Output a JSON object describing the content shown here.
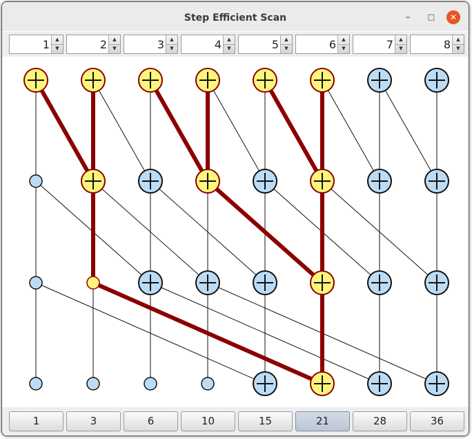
{
  "window": {
    "title": "Step Efficient Scan",
    "minimize_label": "–",
    "maximize_label": "□",
    "close_label": "✕"
  },
  "spinners": [
    {
      "value": "1"
    },
    {
      "value": "2"
    },
    {
      "value": "3"
    },
    {
      "value": "4"
    },
    {
      "value": "5"
    },
    {
      "value": "6"
    },
    {
      "value": "7"
    },
    {
      "value": "8"
    }
  ],
  "results": [
    {
      "label": "1"
    },
    {
      "label": "3"
    },
    {
      "label": "6"
    },
    {
      "label": "10"
    },
    {
      "label": "15"
    },
    {
      "label": "21",
      "active": true
    },
    {
      "label": "28"
    },
    {
      "label": "36"
    }
  ],
  "colors": {
    "highlight_fill": "#fdf57c",
    "highlight_stroke": "#8b0000",
    "normal_fill": "#bcdcf5",
    "normal_stroke": "#111111",
    "path": "#8b0000",
    "edge": "#111111"
  },
  "graph": {
    "nodes": [
      {
        "col": 0,
        "level": 0,
        "type": "add",
        "highlight": true
      },
      {
        "col": 1,
        "level": 0,
        "type": "add",
        "highlight": true
      },
      {
        "col": 2,
        "level": 0,
        "type": "add",
        "highlight": true
      },
      {
        "col": 3,
        "level": 0,
        "type": "add",
        "highlight": true
      },
      {
        "col": 4,
        "level": 0,
        "type": "add",
        "highlight": true
      },
      {
        "col": 5,
        "level": 0,
        "type": "add",
        "highlight": true
      },
      {
        "col": 6,
        "level": 0,
        "type": "add",
        "highlight": false
      },
      {
        "col": 7,
        "level": 0,
        "type": "add",
        "highlight": false
      },
      {
        "col": 0,
        "level": 1,
        "type": "pass",
        "highlight": false
      },
      {
        "col": 1,
        "level": 1,
        "type": "add",
        "highlight": true
      },
      {
        "col": 2,
        "level": 1,
        "type": "add",
        "highlight": false
      },
      {
        "col": 3,
        "level": 1,
        "type": "add",
        "highlight": true
      },
      {
        "col": 4,
        "level": 1,
        "type": "add",
        "highlight": false
      },
      {
        "col": 5,
        "level": 1,
        "type": "add",
        "highlight": true
      },
      {
        "col": 6,
        "level": 1,
        "type": "add",
        "highlight": false
      },
      {
        "col": 7,
        "level": 1,
        "type": "add",
        "highlight": false
      },
      {
        "col": 0,
        "level": 2,
        "type": "pass",
        "highlight": false
      },
      {
        "col": 1,
        "level": 2,
        "type": "pass",
        "highlight": true
      },
      {
        "col": 2,
        "level": 2,
        "type": "add",
        "highlight": false
      },
      {
        "col": 3,
        "level": 2,
        "type": "add",
        "highlight": false
      },
      {
        "col": 4,
        "level": 2,
        "type": "add",
        "highlight": false
      },
      {
        "col": 5,
        "level": 2,
        "type": "add",
        "highlight": true
      },
      {
        "col": 6,
        "level": 2,
        "type": "add",
        "highlight": false
      },
      {
        "col": 7,
        "level": 2,
        "type": "add",
        "highlight": false
      },
      {
        "col": 0,
        "level": 3,
        "type": "pass",
        "highlight": false
      },
      {
        "col": 1,
        "level": 3,
        "type": "pass",
        "highlight": false
      },
      {
        "col": 2,
        "level": 3,
        "type": "pass",
        "highlight": false
      },
      {
        "col": 3,
        "level": 3,
        "type": "pass",
        "highlight": false
      },
      {
        "col": 4,
        "level": 3,
        "type": "add",
        "highlight": false
      },
      {
        "col": 5,
        "level": 3,
        "type": "add",
        "highlight": true
      },
      {
        "col": 6,
        "level": 3,
        "type": "add",
        "highlight": false
      },
      {
        "col": 7,
        "level": 3,
        "type": "add",
        "highlight": false
      }
    ],
    "edges": [
      {
        "from": [
          0,
          0
        ],
        "to": [
          0,
          1
        ],
        "highlight": false
      },
      {
        "from": [
          0,
          0
        ],
        "to": [
          1,
          1
        ],
        "highlight": true
      },
      {
        "from": [
          1,
          0
        ],
        "to": [
          1,
          1
        ],
        "highlight": true
      },
      {
        "from": [
          1,
          0
        ],
        "to": [
          2,
          1
        ],
        "highlight": false
      },
      {
        "from": [
          2,
          0
        ],
        "to": [
          2,
          1
        ],
        "highlight": false
      },
      {
        "from": [
          2,
          0
        ],
        "to": [
          3,
          1
        ],
        "highlight": true
      },
      {
        "from": [
          3,
          0
        ],
        "to": [
          3,
          1
        ],
        "highlight": true
      },
      {
        "from": [
          3,
          0
        ],
        "to": [
          4,
          1
        ],
        "highlight": false
      },
      {
        "from": [
          4,
          0
        ],
        "to": [
          4,
          1
        ],
        "highlight": false
      },
      {
        "from": [
          4,
          0
        ],
        "to": [
          5,
          1
        ],
        "highlight": true
      },
      {
        "from": [
          5,
          0
        ],
        "to": [
          5,
          1
        ],
        "highlight": true
      },
      {
        "from": [
          5,
          0
        ],
        "to": [
          6,
          1
        ],
        "highlight": false
      },
      {
        "from": [
          6,
          0
        ],
        "to": [
          6,
          1
        ],
        "highlight": false
      },
      {
        "from": [
          6,
          0
        ],
        "to": [
          7,
          1
        ],
        "highlight": false
      },
      {
        "from": [
          7,
          0
        ],
        "to": [
          7,
          1
        ],
        "highlight": false
      },
      {
        "from": [
          0,
          1
        ],
        "to": [
          0,
          2
        ],
        "highlight": false
      },
      {
        "from": [
          0,
          1
        ],
        "to": [
          2,
          2
        ],
        "highlight": false
      },
      {
        "from": [
          1,
          1
        ],
        "to": [
          1,
          2
        ],
        "highlight": true
      },
      {
        "from": [
          1,
          1
        ],
        "to": [
          3,
          2
        ],
        "highlight": false
      },
      {
        "from": [
          2,
          1
        ],
        "to": [
          2,
          2
        ],
        "highlight": false
      },
      {
        "from": [
          2,
          1
        ],
        "to": [
          4,
          2
        ],
        "highlight": false
      },
      {
        "from": [
          3,
          1
        ],
        "to": [
          3,
          2
        ],
        "highlight": false
      },
      {
        "from": [
          3,
          1
        ],
        "to": [
          5,
          2
        ],
        "highlight": true
      },
      {
        "from": [
          4,
          1
        ],
        "to": [
          4,
          2
        ],
        "highlight": false
      },
      {
        "from": [
          4,
          1
        ],
        "to": [
          6,
          2
        ],
        "highlight": false
      },
      {
        "from": [
          5,
          1
        ],
        "to": [
          5,
          2
        ],
        "highlight": true
      },
      {
        "from": [
          5,
          1
        ],
        "to": [
          7,
          2
        ],
        "highlight": false
      },
      {
        "from": [
          6,
          1
        ],
        "to": [
          6,
          2
        ],
        "highlight": false
      },
      {
        "from": [
          7,
          1
        ],
        "to": [
          7,
          2
        ],
        "highlight": false
      },
      {
        "from": [
          0,
          2
        ],
        "to": [
          0,
          3
        ],
        "highlight": false
      },
      {
        "from": [
          0,
          2
        ],
        "to": [
          4,
          3
        ],
        "highlight": false
      },
      {
        "from": [
          1,
          2
        ],
        "to": [
          1,
          3
        ],
        "highlight": false
      },
      {
        "from": [
          1,
          2
        ],
        "to": [
          5,
          3
        ],
        "highlight": true
      },
      {
        "from": [
          2,
          2
        ],
        "to": [
          2,
          3
        ],
        "highlight": false
      },
      {
        "from": [
          2,
          2
        ],
        "to": [
          6,
          3
        ],
        "highlight": false
      },
      {
        "from": [
          3,
          2
        ],
        "to": [
          3,
          3
        ],
        "highlight": false
      },
      {
        "from": [
          3,
          2
        ],
        "to": [
          7,
          3
        ],
        "highlight": false
      },
      {
        "from": [
          4,
          2
        ],
        "to": [
          4,
          3
        ],
        "highlight": false
      },
      {
        "from": [
          5,
          2
        ],
        "to": [
          5,
          3
        ],
        "highlight": true
      },
      {
        "from": [
          6,
          2
        ],
        "to": [
          6,
          3
        ],
        "highlight": false
      },
      {
        "from": [
          7,
          2
        ],
        "to": [
          7,
          3
        ],
        "highlight": false
      }
    ]
  }
}
